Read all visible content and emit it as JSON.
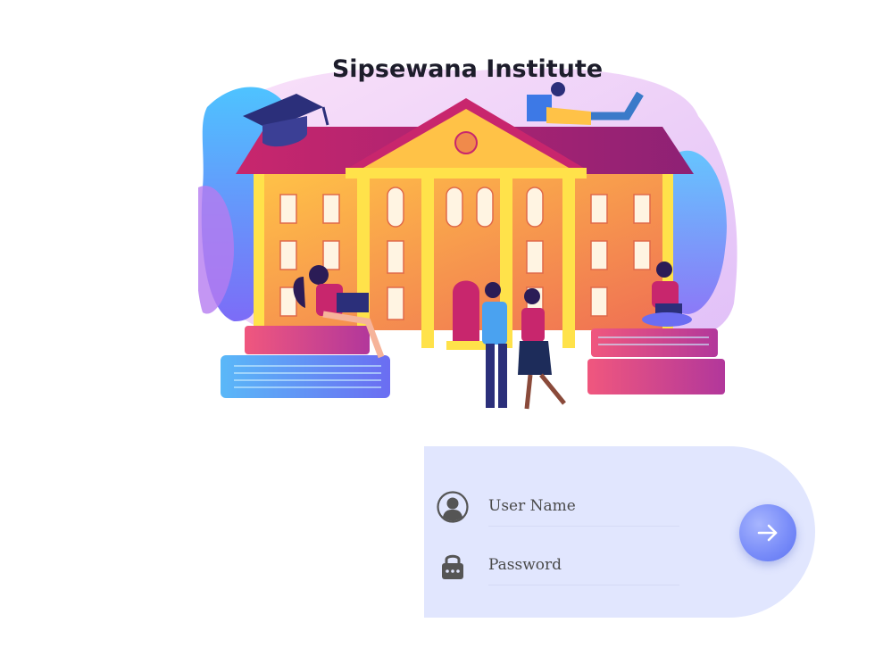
{
  "header": {
    "title": "Sipsewana Institute"
  },
  "login": {
    "username_placeholder": "User Name",
    "password_placeholder": "Password",
    "username_value": "",
    "password_value": "",
    "submit_icon": "arrow-right-icon"
  },
  "icons": {
    "user": "user-circle-icon",
    "password": "lock-icon"
  },
  "colors": {
    "card_background": "#e1e6fe",
    "button_accent": "#7b8ef9",
    "title_text": "#1d1d2b",
    "icon_color": "#555555"
  }
}
